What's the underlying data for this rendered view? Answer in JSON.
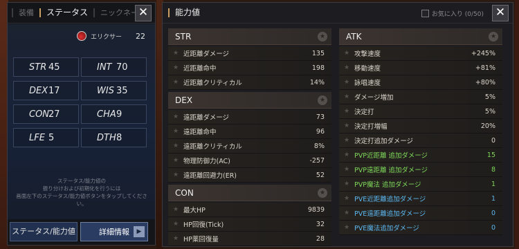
{
  "left_panel": {
    "tabs": [
      "装備",
      "ステータス",
      "ニックネーム"
    ],
    "close_label": "✕",
    "elixir": {
      "label": "エリクサー",
      "value": "22"
    },
    "stats": [
      {
        "key": "STR",
        "value": "45"
      },
      {
        "key": "INT",
        "value": "70"
      },
      {
        "key": "DEX",
        "value": "17"
      },
      {
        "key": "WIS",
        "value": "35"
      },
      {
        "key": "CON",
        "value": "27"
      },
      {
        "key": "CHA",
        "value": "9"
      },
      {
        "key": "LFE",
        "value": "5"
      },
      {
        "key": "DTH",
        "value": "8"
      }
    ],
    "note": [
      "ステータス/能力値の",
      "振り分けおよび初期化を行うには",
      "画面左下のステータス/能力値ボタンをタップしてください。"
    ],
    "buttons": {
      "status": "ステータス/能力値",
      "detail": "詳細情報",
      "detail_arrow": "▶"
    }
  },
  "right_panel": {
    "title": "能力値",
    "favorites": "お気に入り (0/50)",
    "close_label": "✕",
    "star": "★",
    "sections": {
      "str": {
        "title": "STR",
        "rows": [
          {
            "label": "近距離ダメージ",
            "value": "135"
          },
          {
            "label": "近距離命中",
            "value": "198"
          },
          {
            "label": "近距離クリティカル",
            "value": "14%"
          }
        ]
      },
      "dex": {
        "title": "DEX",
        "rows": [
          {
            "label": "遠距離ダメージ",
            "value": "73"
          },
          {
            "label": "遠距離命中",
            "value": "96"
          },
          {
            "label": "遠距離クリティカル",
            "value": "8%"
          },
          {
            "label": "物理防御力(AC)",
            "value": "-257"
          },
          {
            "label": "遠距離回避力(ER)",
            "value": "52"
          }
        ]
      },
      "con": {
        "title": "CON",
        "rows": [
          {
            "label": "最大HP",
            "value": "9839"
          },
          {
            "label": "HP回復(Tick)",
            "value": "32"
          },
          {
            "label": "HP薬回復量",
            "value": "28"
          }
        ]
      },
      "atk": {
        "title": "ATK",
        "rows": [
          {
            "label": "攻撃速度",
            "value": "+245%",
            "color": "normal"
          },
          {
            "label": "移動速度",
            "value": "+81%",
            "color": "normal"
          },
          {
            "label": "詠唱速度",
            "value": "+80%",
            "color": "normal"
          },
          {
            "label": "ダメージ増加",
            "value": "5%",
            "color": "normal"
          },
          {
            "label": "決定打",
            "value": "5%",
            "color": "normal"
          },
          {
            "label": "決定打増幅",
            "value": "20%",
            "color": "normal"
          },
          {
            "label": "決定打追加ダメージ",
            "value": "0",
            "color": "normal"
          },
          {
            "label": "PVP近距離 追加ダメージ",
            "value": "15",
            "color": "green"
          },
          {
            "label": "PVP遠距離 追加ダメージ",
            "value": "8",
            "color": "green"
          },
          {
            "label": "PVP魔法 追加ダメージ",
            "value": "1",
            "color": "green"
          },
          {
            "label": "PVE近距離追加ダメージ",
            "value": "1",
            "color": "blue"
          },
          {
            "label": "PVE遠距離追加ダメージ",
            "value": "0",
            "color": "blue"
          },
          {
            "label": "PVE魔法追加ダメージ",
            "value": "0",
            "color": "blue"
          }
        ]
      }
    }
  },
  "colors": {
    "accent": "#c9a060",
    "pvp_green": "#7ed85a",
    "pve_blue": "#5cb8f0"
  }
}
